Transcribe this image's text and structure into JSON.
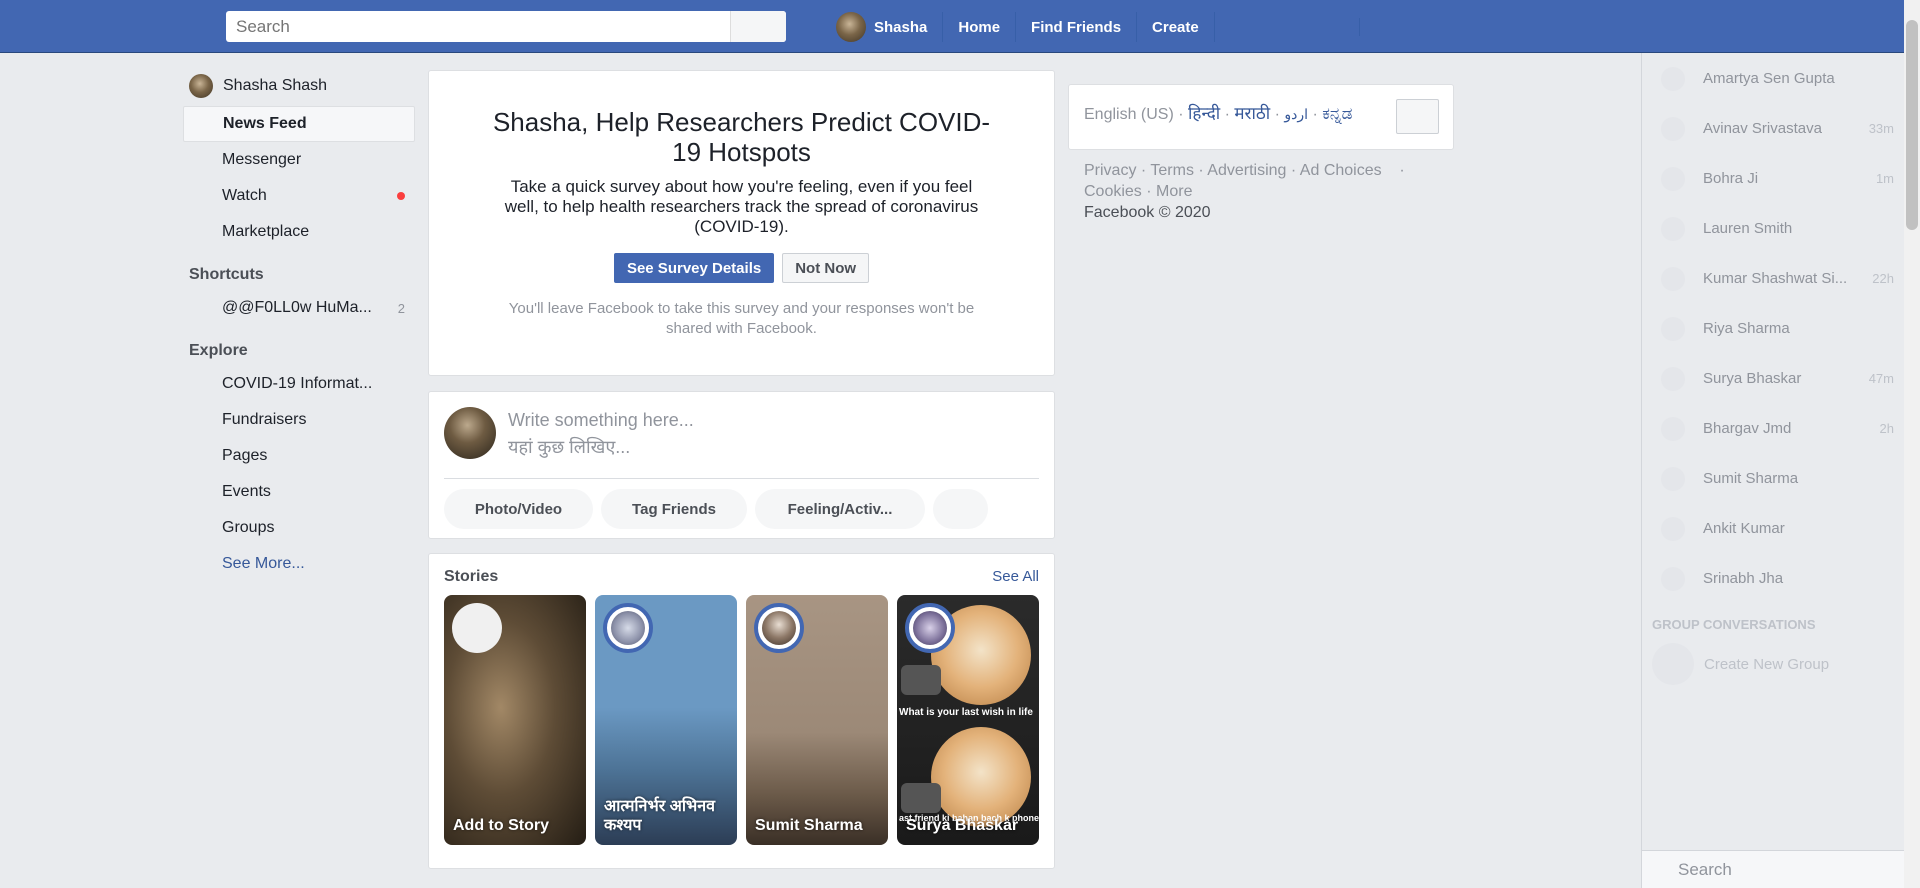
{
  "header": {
    "search_placeholder": "Search",
    "profile_name": "Shasha",
    "nav": [
      "Home",
      "Find Friends",
      "Create"
    ]
  },
  "sidebar": {
    "user": "Shasha Shash",
    "items": [
      {
        "label": "News Feed"
      },
      {
        "label": "Messenger"
      },
      {
        "label": "Watch"
      },
      {
        "label": "Marketplace"
      }
    ],
    "shortcuts_title": "Shortcuts",
    "shortcuts": [
      {
        "label": "@@F0LL0w HuMa...",
        "count": "2"
      }
    ],
    "explore_title": "Explore",
    "explore": [
      "COVID-19 Informat...",
      "Fundraisers",
      "Pages",
      "Events",
      "Groups"
    ],
    "see_more": "See More..."
  },
  "survey": {
    "title": "Shasha, Help Researchers Predict COVID-19 Hotspots",
    "description": "Take a quick survey about how you're feeling, even if you feel well, to help health researchers track the spread of coronavirus (COVID-19).",
    "primary_button": "See Survey Details",
    "secondary_button": "Not Now",
    "note": "You'll leave Facebook to take this survey and your responses won't be shared with Facebook."
  },
  "composer": {
    "placeholder_en": "Write something here...",
    "placeholder_hi": "यहां कुछ लिखिए...",
    "buttons": [
      "Photo/Video",
      "Tag Friends",
      "Feeling/Activ..."
    ]
  },
  "stories": {
    "title": "Stories",
    "see_all": "See All",
    "items": [
      {
        "name": "Add to Story"
      },
      {
        "name": "आत्मनिर्भर अभिनव कश्यप"
      },
      {
        "name": "Sumit Sharma"
      },
      {
        "name": "Surya Bhaskar"
      }
    ],
    "meme_caption_1": "What is your last wish in life",
    "meme_caption_2": "ast friend ki bahan bach k phone lena hai"
  },
  "languages": {
    "current": "English (US)",
    "others": [
      "हिन्दी",
      "मराठी",
      "اردو",
      "ಕನ್ನಡ"
    ]
  },
  "footer": {
    "links": [
      "Privacy",
      "Terms",
      "Advertising",
      "Ad Choices",
      "Cookies",
      "More"
    ],
    "copyright": "Facebook © 2020"
  },
  "chat": {
    "contacts": [
      {
        "name": "Amartya Sen Gupta",
        "time": ""
      },
      {
        "name": "Avinav Srivastava",
        "time": "33m"
      },
      {
        "name": "Bohra Ji",
        "time": "1m"
      },
      {
        "name": "Lauren Smith",
        "time": ""
      },
      {
        "name": "Kumar Shashwat Si...",
        "time": "22h"
      },
      {
        "name": "Riya Sharma",
        "time": ""
      },
      {
        "name": "Surya Bhaskar",
        "time": "47m"
      },
      {
        "name": "Bhargav Jmd",
        "time": "2h"
      },
      {
        "name": "Sumit Sharma",
        "time": ""
      },
      {
        "name": "Ankit Kumar",
        "time": ""
      },
      {
        "name": "Srinabh Jha",
        "time": ""
      }
    ],
    "group_title": "GROUP CONVERSATIONS",
    "create_group": "Create New Group",
    "search": "Search"
  },
  "colors": {
    "brand": "#4267b2",
    "link": "#365899",
    "notification": "#fa3e3e"
  }
}
